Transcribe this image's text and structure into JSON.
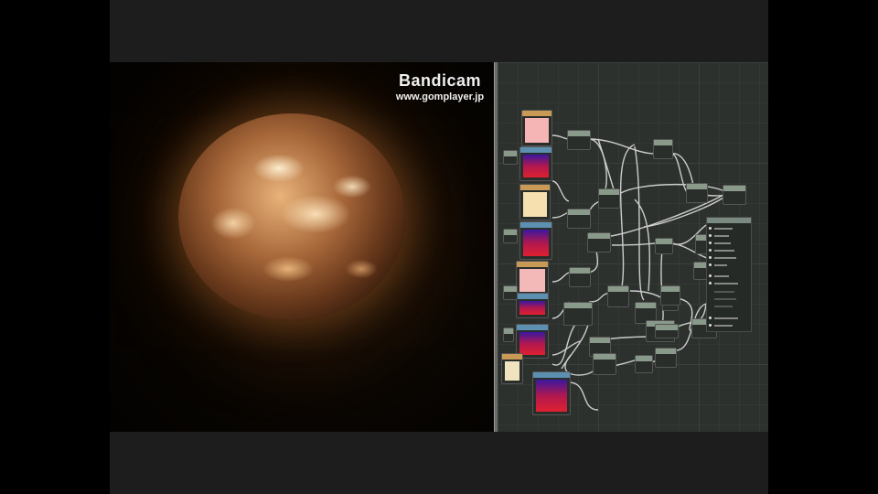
{
  "watermark": {
    "title": "Bandicam",
    "url": "www.gomplayer.jp"
  },
  "viewport": {
    "subject": "glowing sphere"
  },
  "graph": {
    "background_color": "#2c312d",
    "wire_color": "#e8e8e8",
    "node_header_colors": {
      "texture": "#c89a55",
      "ramp": "#5c8fb0",
      "operator": "#8a9a8a",
      "output": "#7a8a80"
    },
    "swatch_colors": [
      "#f5b5b5",
      "#f6e0b0",
      "#f3b8b8",
      "#f0e4c0"
    ],
    "ramp_gradient": [
      "#3a18a0",
      "#b01850",
      "#e02030"
    ]
  }
}
